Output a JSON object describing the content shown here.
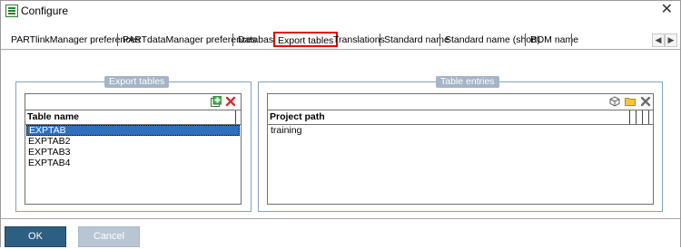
{
  "window": {
    "title": "Configure",
    "close_glyph": "✕"
  },
  "tabs": [
    {
      "label": "PARTlinkManager preferences"
    },
    {
      "label": "PARTdataManager preferences"
    },
    {
      "label": "Database"
    },
    {
      "label": "Export tables",
      "active": true
    },
    {
      "label": "Translations"
    },
    {
      "label": "Standard name"
    },
    {
      "label": "Standard name (short)"
    },
    {
      "label": "BOM name"
    }
  ],
  "export_tables": {
    "group_title": "Export tables",
    "column_header": "Table name",
    "rows": [
      "EXPTAB",
      "EXPTAB2",
      "EXPTAB3",
      "EXPTAB4"
    ],
    "selected_row": "EXPTAB",
    "toolbar_icons": [
      "add-icon",
      "delete-icon"
    ]
  },
  "table_entries": {
    "group_title": "Table entries",
    "column_header": "Project path",
    "rows": [
      "training"
    ],
    "toolbar_icons": [
      "cube-icon",
      "folder-icon",
      "delete-icon"
    ]
  },
  "footer": {
    "ok_label": "OK",
    "cancel_label": "Cancel"
  },
  "colors": {
    "accent": "#2d5f82",
    "selection": "#2f6fbf",
    "active_tab_border": "#e00000",
    "group_title_bg": "#a4b5c7"
  }
}
